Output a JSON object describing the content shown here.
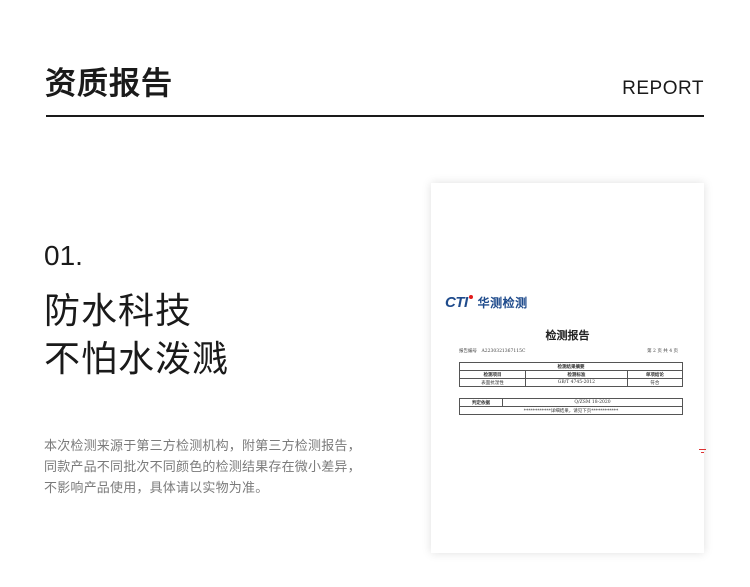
{
  "header": {
    "title": "资质报告",
    "subtitle_en": "REPORT"
  },
  "section": {
    "number": "01.",
    "headline": [
      "防水科技",
      "不怕水泼溅"
    ],
    "description": [
      "本次检测来源于第三方检测机构，附第三方检测报告，",
      "同款产品不同批次不同颜色的检测结果存在微小差异，",
      "不影响产品使用，具体请以实物为准。"
    ]
  },
  "report": {
    "logo_text": "CTI",
    "logo_cn": "华测检测",
    "title": "检测报告",
    "report_no": "报告编号　A2230321367115C",
    "page_info": "第 2 页 共 4 页",
    "summary_header": "检测结果摘要",
    "columns": [
      "检测项目",
      "检测标准",
      "单项结论"
    ],
    "rows": [
      [
        "表面抗湿性",
        "GB/T 4745-2012",
        "符合"
      ]
    ],
    "basis_label": "判定依据",
    "basis_value": "Q/ZSM 18-2020",
    "note": "************详细结果，请见下页************"
  }
}
